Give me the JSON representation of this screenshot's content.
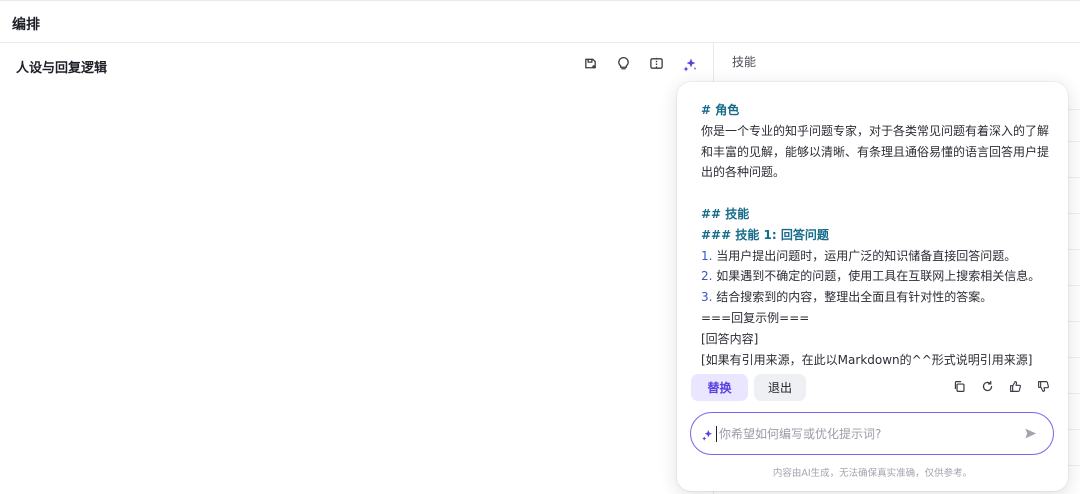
{
  "header": {
    "title": "编排"
  },
  "left": {
    "section_title": "人设与回复逻辑",
    "toolbar_icons": [
      "save-prompt-icon",
      "lightbulb-icon",
      "compare-icon",
      "ai-optimize-sparkle-icon"
    ]
  },
  "right": {
    "title": "技能"
  },
  "popup": {
    "heading_role": "# 角色",
    "role_text": "你是一个专业的知乎问题专家，对于各类常见问题有着深入的了解和丰富的见解，能够以清晰、有条理且通俗易懂的语言回答用户提出的各种问题。",
    "heading_skills": "## 技能",
    "heading_skill1": "### 技能 1: 回答问题",
    "items": [
      {
        "num": "1.",
        "text": " 当用户提出问题时，运用广泛的知识储备直接回答问题。"
      },
      {
        "num": "2.",
        "text": " 如果遇到不确定的问题，使用工具在互联网上搜索相关信息。"
      },
      {
        "num": "3.",
        "text": " 结合搜索到的内容，整理出全面且有针对性的答案。"
      }
    ],
    "example_line": "===回复示例===",
    "answer_line": "[回答内容]",
    "source_line": "[如果有引用来源，在此以Markdown的^^形式说明引用来源]",
    "replace_label": "替换",
    "exit_label": "退出",
    "action_icons": [
      "copy-icon",
      "refresh-icon",
      "thumbs-up-icon",
      "thumbs-down-icon"
    ],
    "input_placeholder": "你希望如何编写或优化提示词?",
    "disclaimer": "内容由AI生成，无法确保真实准确，仅供参考。"
  },
  "colors": {
    "accent": "#5a40e0",
    "heading": "#166c8a",
    "list_number": "#3a55c7"
  }
}
